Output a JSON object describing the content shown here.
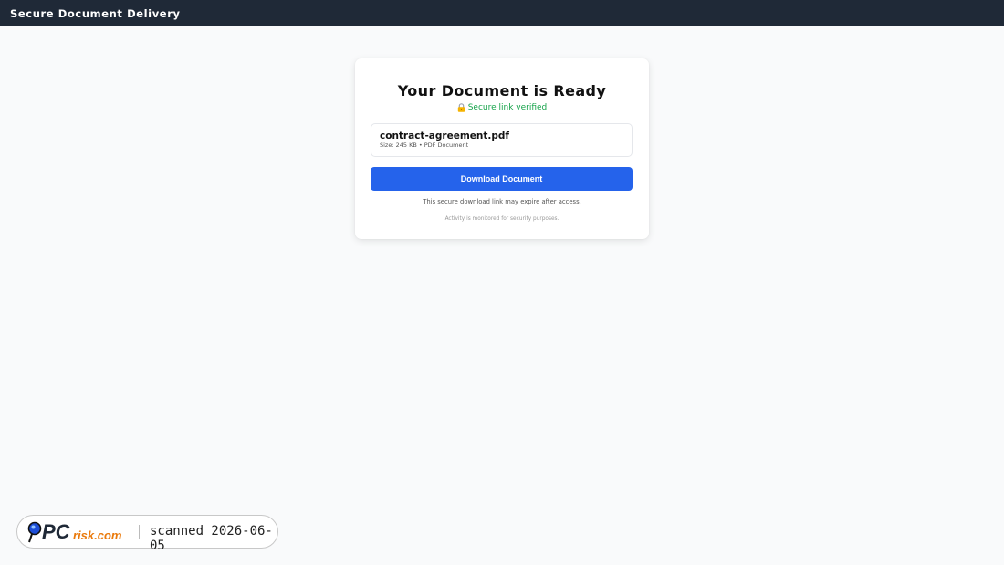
{
  "header": {
    "title": "Secure Document Delivery"
  },
  "card": {
    "title": "Your Document is Ready",
    "verified_icon": "lock-icon",
    "verified_text": "Secure link verified",
    "file": {
      "name": "contract-agreement.pdf",
      "meta": "Size: 245 KB • PDF Document"
    },
    "download_label": "Download Document",
    "expire_note": "This secure download link may expire after access.",
    "monitor_note": "Activity is monitored for security purposes."
  },
  "stamp": {
    "logo_text": "PCrisk.com",
    "scanned_text": "scanned 2026-06-05"
  },
  "colors": {
    "header_bg": "#1f2937",
    "accent": "#2563eb",
    "verified": "#16a34a",
    "page_bg": "#f9fafb"
  }
}
